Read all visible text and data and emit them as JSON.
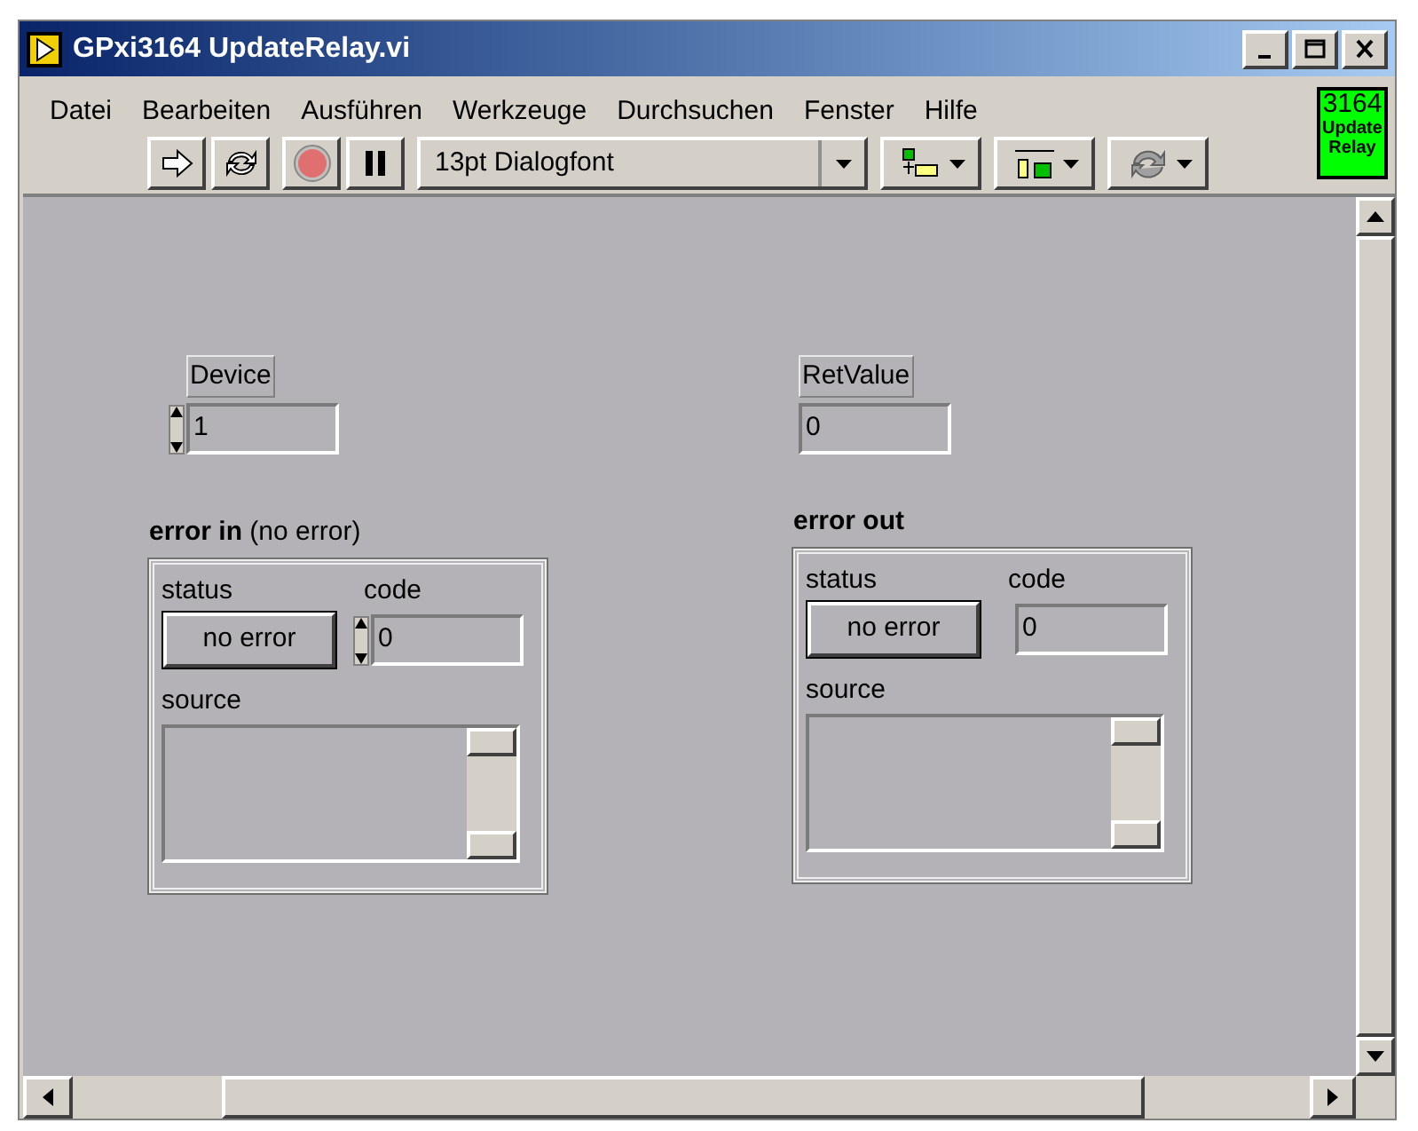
{
  "window": {
    "title": "GPxi3164 UpdateRelay.vi"
  },
  "menu": [
    "Datei",
    "Bearbeiten",
    "Ausführen",
    "Werkzeuge",
    "Durchsuchen",
    "Fenster",
    "Hilfe"
  ],
  "toolbar": {
    "font": "13pt Dialogfont"
  },
  "vi_icon": {
    "number": "3164",
    "caption": "Update Relay"
  },
  "controls": [
    {
      "kind": "numeric",
      "label": "Device",
      "value": "1",
      "spinner": true
    },
    {
      "kind": "numeric",
      "label": "RetValue",
      "value": "0",
      "spinner": false
    },
    {
      "kind": "cluster",
      "label": "error in",
      "note": "(no error)",
      "status_label": "status",
      "status": "no error",
      "code_label": "code",
      "code": "0",
      "code_spinner": true,
      "source_label": "source"
    },
    {
      "kind": "cluster",
      "label": "error out",
      "status_label": "status",
      "status": "no error",
      "code_label": "code",
      "code": "0",
      "code_spinner": false,
      "source_label": "source"
    }
  ]
}
